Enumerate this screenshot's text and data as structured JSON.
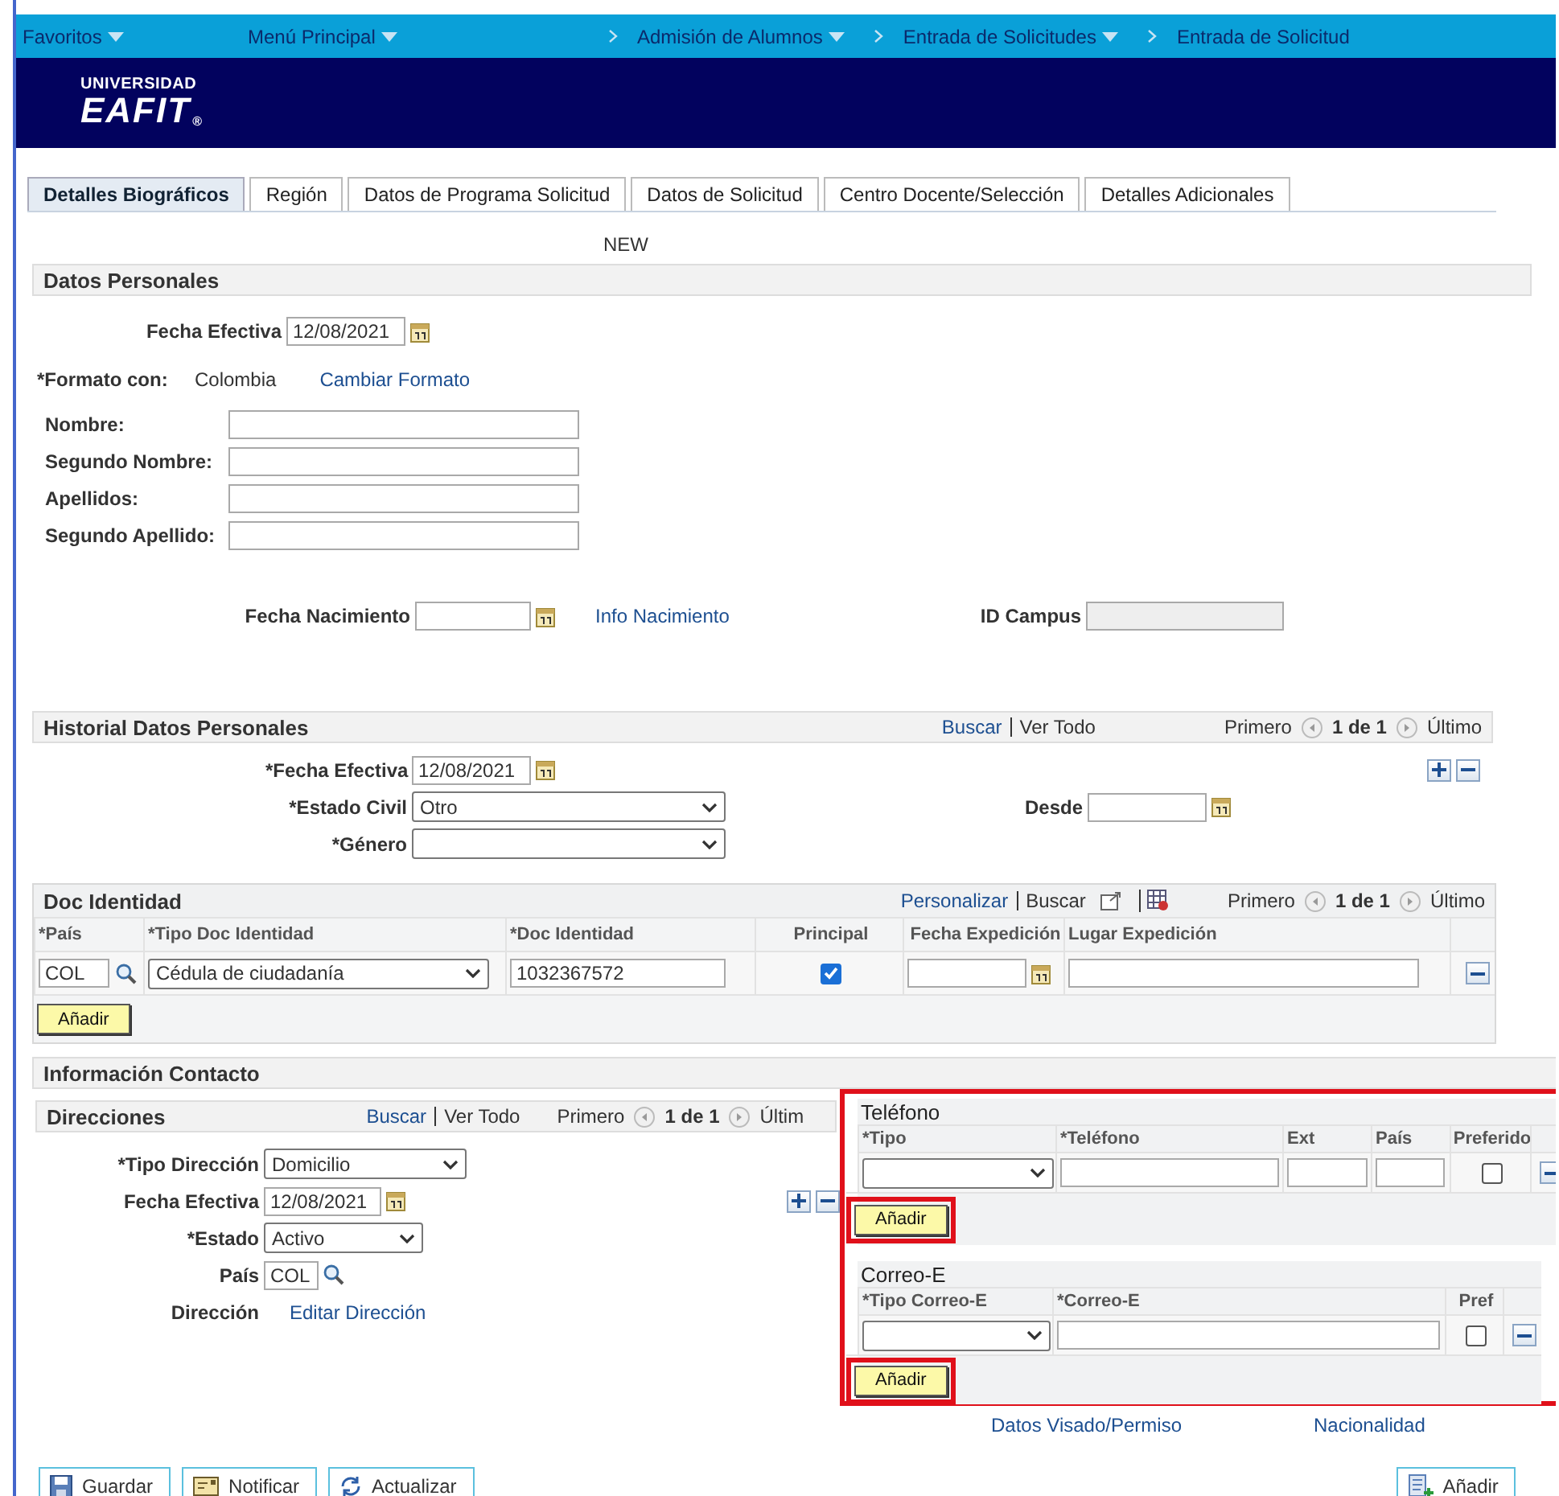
{
  "nav": [
    {
      "label": "Favoritos",
      "dropdown": true,
      "chevron": false
    },
    {
      "label": "Menú Principal",
      "dropdown": true,
      "chevron": false
    },
    {
      "label": "Admisión de Alumnos",
      "dropdown": true,
      "chevron": true
    },
    {
      "label": "Entrada de Solicitudes",
      "dropdown": true,
      "chevron": true
    },
    {
      "label": "Entrada de Solicitud",
      "dropdown": false,
      "chevron": true
    }
  ],
  "logo": {
    "top": "UNIVERSIDAD",
    "main": "EAFIT",
    "mark": "®"
  },
  "tabs": [
    {
      "label": "Detalles Biográficos",
      "selected": true
    },
    {
      "label": "Región",
      "selected": false
    },
    {
      "label": "Datos de Programa Solicitud",
      "selected": false
    },
    {
      "label": "Datos de Solicitud",
      "selected": false
    },
    {
      "label": "Centro Docente/Selección",
      "selected": false
    },
    {
      "label": "Detalles Adicionales",
      "selected": false
    }
  ],
  "mode": "NEW",
  "datos_personales": {
    "title": "Datos Personales",
    "fecha_efectiva": {
      "label": "Fecha Efectiva",
      "value": "12/08/2021"
    },
    "formato": {
      "label": "*Formato con:",
      "value": "Colombia",
      "link": "Cambiar Formato"
    },
    "names": [
      {
        "label": "Nombre:"
      },
      {
        "label": "Segundo Nombre:"
      },
      {
        "label": "Apellidos:"
      },
      {
        "label": "Segundo Apellido:"
      }
    ],
    "fecha_nacimiento": {
      "label": "Fecha Nacimiento",
      "link": "Info Nacimiento"
    },
    "id_campus": {
      "label": "ID Campus",
      "disabled": true
    }
  },
  "historial": {
    "title": "Historial Datos Personales",
    "links": [
      "Buscar",
      "Ver Todo"
    ],
    "pager": {
      "first": "Primero",
      "count": "1 de 1",
      "last": "Último"
    },
    "fecha_efectiva": {
      "label": "*Fecha Efectiva",
      "value": "12/08/2021"
    },
    "estado_civil": {
      "label": "*Estado Civil",
      "value": "Otro"
    },
    "genero": {
      "label": "*Género"
    },
    "desde": {
      "label": "Desde"
    }
  },
  "doc_identidad": {
    "title": "Doc Identidad",
    "links": [
      "Personalizar",
      "Buscar"
    ],
    "pager": {
      "first": "Primero",
      "count": "1 de 1",
      "last": "Último"
    },
    "columns": [
      "*País",
      "*Tipo Doc Identidad",
      "*Doc Identidad",
      "Principal",
      "Fecha Expedición",
      "Lugar Expedición"
    ],
    "row": {
      "pais": "COL",
      "tipo": "Cédula de ciudadanía",
      "doc": "1032367572",
      "principal": true
    },
    "add": "Añadir"
  },
  "contacto": {
    "title": "Información Contacto"
  },
  "direcciones": {
    "title": "Direcciones",
    "links": [
      "Buscar",
      "Ver Todo"
    ],
    "pager": {
      "first": "Primero",
      "count": "1 de 1",
      "last": "Últim"
    },
    "tipo": {
      "label": "*Tipo Dirección",
      "value": "Domicilio"
    },
    "fecha": {
      "label": "Fecha Efectiva",
      "value": "12/08/2021"
    },
    "estado": {
      "label": "*Estado",
      "value": "Activo"
    },
    "pais": {
      "label": "País",
      "value": "COL"
    },
    "direccion": {
      "label": "Dirección",
      "link": "Editar Dirección"
    }
  },
  "telefono": {
    "title": "Teléfono",
    "columns": [
      "*Tipo",
      "*Teléfono",
      "Ext",
      "País",
      "Preferido"
    ],
    "preferido": false,
    "add": "Añadir"
  },
  "correo": {
    "title": "Correo-E",
    "columns": [
      "*Tipo Correo-E",
      "*Correo-E",
      "Pref"
    ],
    "pref": false,
    "add": "Añadir"
  },
  "bottom_links": [
    "Datos Visado/Permiso",
    "Nacionalidad"
  ],
  "footer": [
    {
      "kind": "save",
      "label": "Guardar"
    },
    {
      "kind": "notify",
      "label": "Notificar"
    },
    {
      "kind": "refresh",
      "label": "Actualizar"
    },
    {
      "kind": "add",
      "label": "Añadir"
    }
  ]
}
